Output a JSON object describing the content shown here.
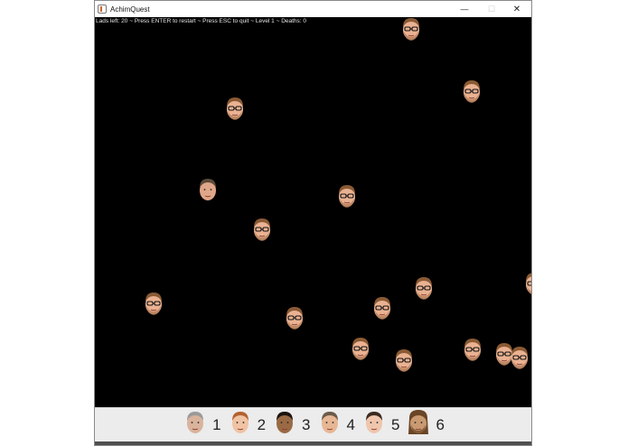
{
  "window": {
    "title": "AchimQuest",
    "minimize_glyph": "—",
    "maximize_glyph": "☐",
    "close_glyph": "✕"
  },
  "hud": {
    "text": "Lads left: 20 ~ Press ENTER to restart ~ Press ESC to quit ~ Level 1 ~ Deaths: 0"
  },
  "enemy_icon": "bearded-face-with-glasses-icon",
  "player_icon": "player-face-icon",
  "characters": [
    {
      "num": "1",
      "icon": "gray-haired-man-face-icon"
    },
    {
      "num": "2",
      "icon": "red-haired-man-face-icon"
    },
    {
      "num": "3",
      "icon": "dark-haired-man-face-icon"
    },
    {
      "num": "4",
      "icon": "smiling-man-face-icon"
    },
    {
      "num": "5",
      "icon": "young-man-face-icon"
    },
    {
      "num": "6",
      "icon": "long-haired-bearded-man-face-icon"
    }
  ],
  "colors": {
    "canvas": "#000000",
    "bar": "#ececec",
    "hud_text": "#e6e6e6"
  }
}
